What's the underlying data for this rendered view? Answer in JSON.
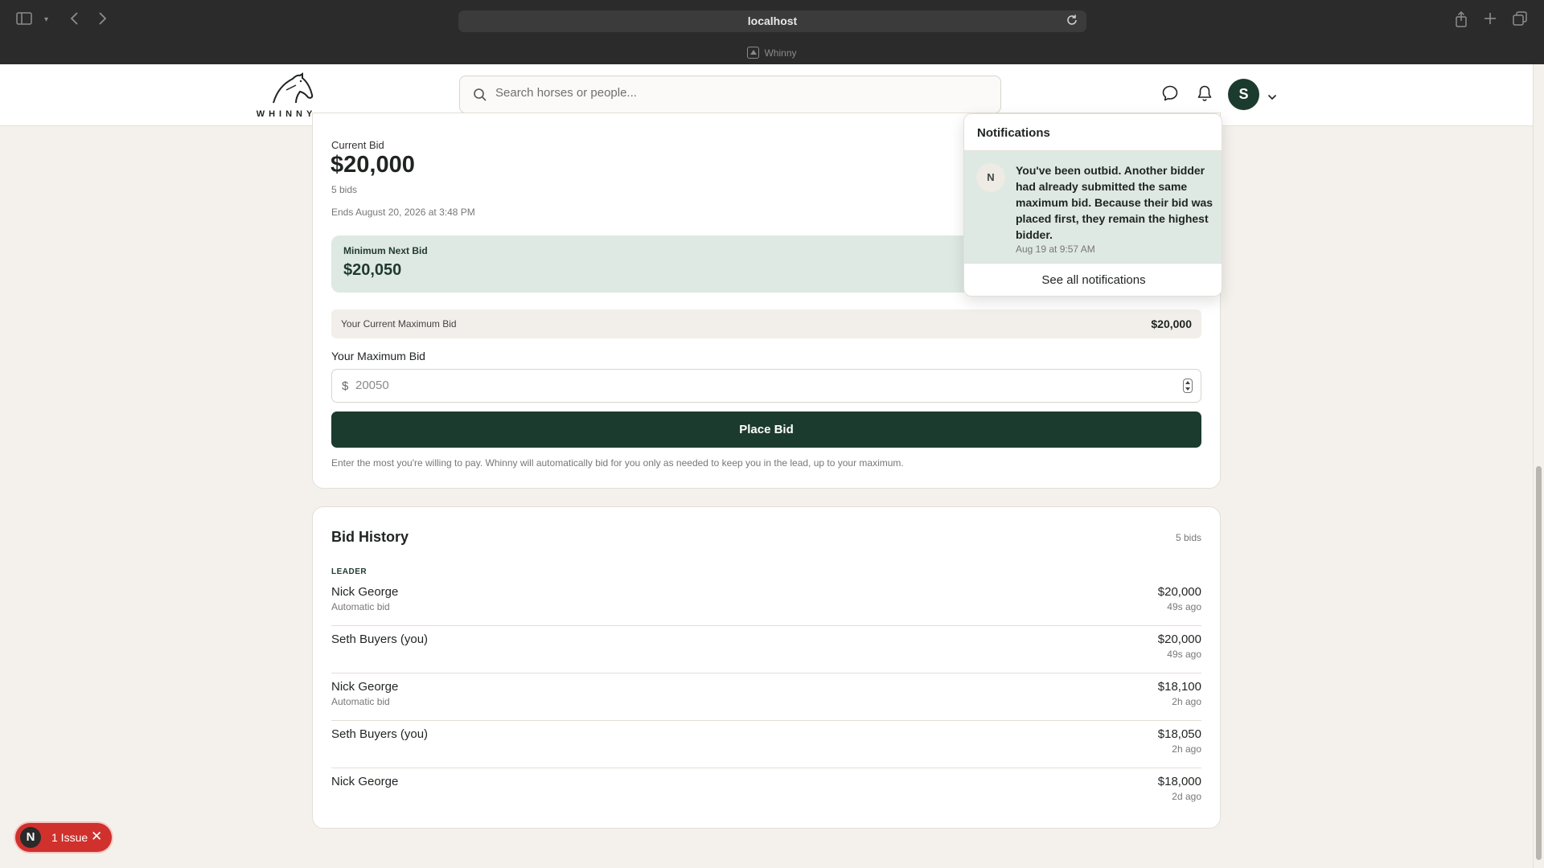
{
  "browser": {
    "url": "localhost",
    "tab_title": "Whinny"
  },
  "header": {
    "logo_text": "WHINNY",
    "search_placeholder": "Search horses or people...",
    "avatar_initial": "S"
  },
  "bid_panel": {
    "current_bid_label": "Current Bid",
    "current_bid": "$20,000",
    "bid_count": "5 bids",
    "ends": "Ends August 20, 2026 at 3:48 PM",
    "min_next_label": "Minimum Next Bid",
    "min_next_value": "$20,050",
    "current_max_label": "Your Current Maximum Bid",
    "current_max_value": "$20,000",
    "max_bid_label": "Your Maximum Bid",
    "currency_symbol": "$",
    "max_bid_placeholder": "20050",
    "place_bid_label": "Place Bid",
    "help_text": "Enter the most you're willing to pay. Whinny will automatically bid for you only as needed to keep you in the lead, up to your maximum."
  },
  "bid_history": {
    "title": "Bid History",
    "count": "5 bids",
    "leader_label": "LEADER",
    "rows": [
      {
        "name": "Nick George",
        "sub": "Automatic bid",
        "amount": "$20,000",
        "time": "49s ago"
      },
      {
        "name": "Seth Buyers (you)",
        "sub": "",
        "amount": "$20,000",
        "time": "49s ago"
      },
      {
        "name": "Nick George",
        "sub": "Automatic bid",
        "amount": "$18,100",
        "time": "2h ago"
      },
      {
        "name": "Seth Buyers (you)",
        "sub": "",
        "amount": "$18,050",
        "time": "2h ago"
      },
      {
        "name": "Nick George",
        "sub": "",
        "amount": "$18,000",
        "time": "2d ago"
      }
    ]
  },
  "notifications": {
    "title": "Notifications",
    "items": [
      {
        "avatar": "N",
        "message": "You've been outbid. Another bidder had already submitted the same maximum bid. Because their bid was placed first, they remain the highest bidder.",
        "time": "Aug 19 at 9:57 AM"
      }
    ],
    "see_all_label": "See all notifications"
  },
  "issue_badge": {
    "initial": "N",
    "label": "1 Issue",
    "close": "✕"
  },
  "colors": {
    "brand_dark_green": "#1c3b2f",
    "highlight_green": "#dfe9e3",
    "page_bg": "#f4f1ec",
    "issue_red": "#d0312d"
  }
}
